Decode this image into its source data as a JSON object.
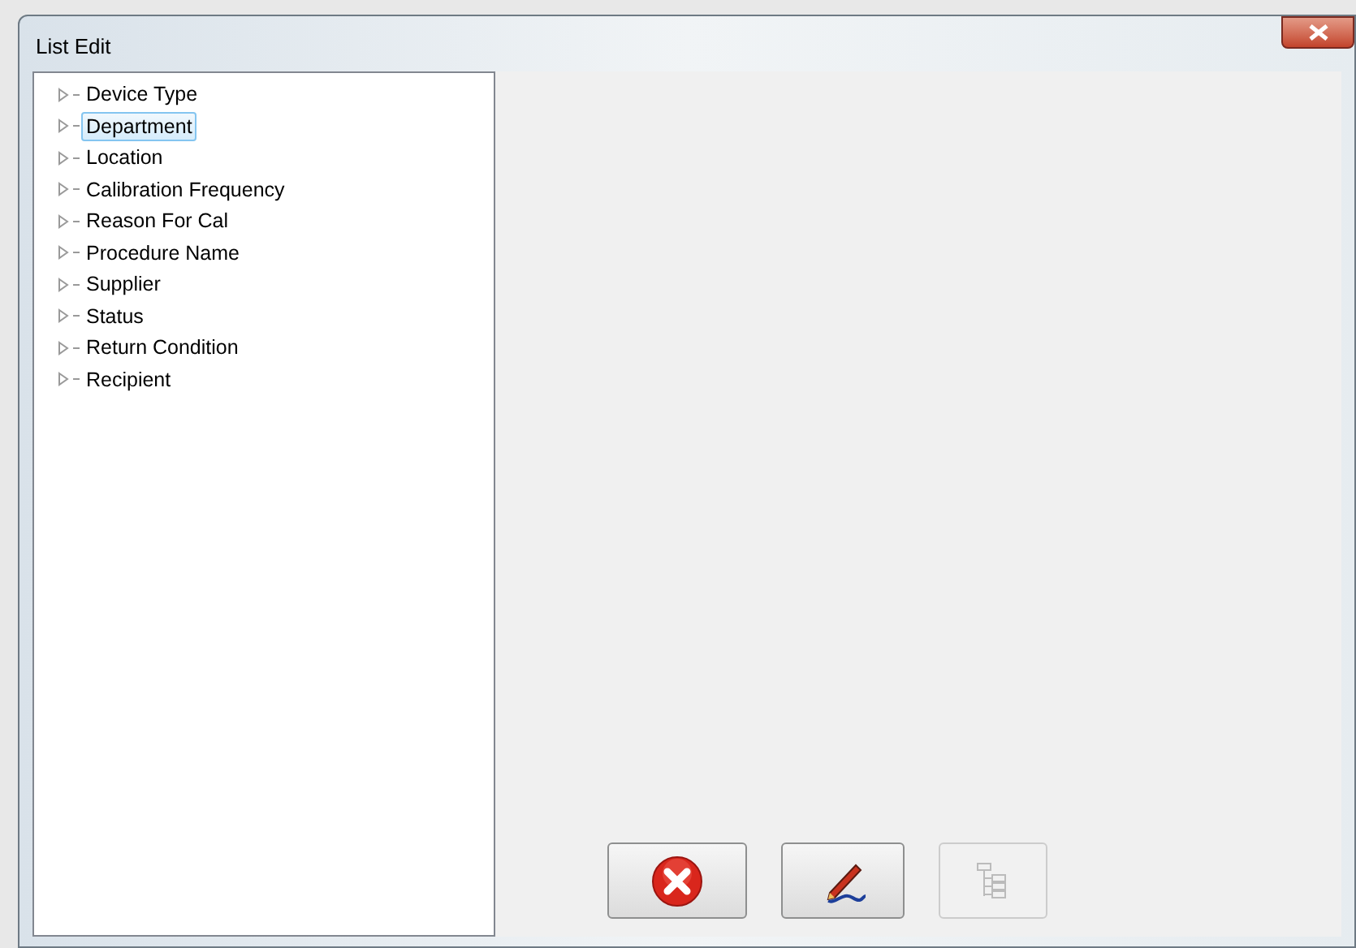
{
  "window": {
    "title": "List Edit"
  },
  "tree": {
    "items": [
      {
        "label": "Device Type",
        "selected": false,
        "expanded": false
      },
      {
        "label": "Department",
        "selected": true,
        "expanded": false
      },
      {
        "label": "Location",
        "selected": false,
        "expanded": false
      },
      {
        "label": "Calibration Frequency",
        "selected": false,
        "expanded": false
      },
      {
        "label": "Reason For Cal",
        "selected": false,
        "expanded": false
      },
      {
        "label": "Procedure Name",
        "selected": false,
        "expanded": false
      },
      {
        "label": "Supplier",
        "selected": false,
        "expanded": false
      },
      {
        "label": "Status",
        "selected": false,
        "expanded": false
      },
      {
        "label": "Return Condition",
        "selected": false,
        "expanded": false
      },
      {
        "label": "Recipient",
        "selected": false,
        "expanded": false
      }
    ]
  },
  "buttons": [
    {
      "kind": "cancel",
      "disabled": false
    },
    {
      "kind": "edit",
      "disabled": false
    },
    {
      "kind": "hierarchy",
      "disabled": true
    }
  ]
}
